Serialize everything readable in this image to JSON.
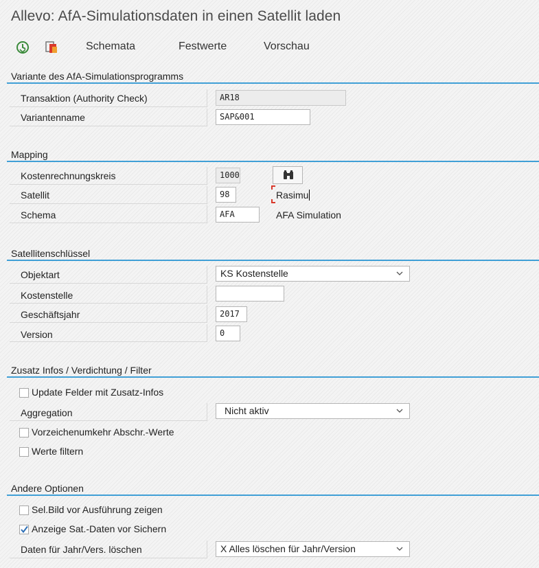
{
  "window": {
    "title": "Allevo: AfA-Simulationsdaten in einen Satellit laden"
  },
  "toolbar": {
    "execute_icon": "execute-clock-icon",
    "variant_icon": "variant-copy-icon",
    "schemata": "Schemata",
    "festwerte": "Festwerte",
    "vorschau": "Vorschau"
  },
  "variante": {
    "title": "Variante des AfA-Simulationsprogramms",
    "transaktion_label": "Transaktion (Authority Check)",
    "transaktion_value": "AR18",
    "variantenname_label": "Variantenname",
    "variantenname_value": "SAP&001"
  },
  "mapping": {
    "title": "Mapping",
    "kostenrechnungskreis_label": "Kostenrechnungskreis",
    "kostenrechnungskreis_value": "1000",
    "satellit_label": "Satellit",
    "satellit_value": "98",
    "satellit_text": "Rasimu",
    "schema_label": "Schema",
    "schema_value": "AFA",
    "schema_text": "AFA Simulation"
  },
  "schluessel": {
    "title": "Satellitenschlüssel",
    "objektart_label": "Objektart",
    "objektart_value": "KS Kostenstelle",
    "kostenstelle_label": "Kostenstelle",
    "kostenstelle_value": "",
    "geschaeftsjahr_label": "Geschäftsjahr",
    "geschaeftsjahr_value": "2017",
    "version_label": "Version",
    "version_value": "0"
  },
  "zusatz": {
    "title": "Zusatz Infos / Verdichtung / Filter",
    "update_label": "Update Felder mit Zusatz-Infos",
    "update_checked": false,
    "aggregation_label": "Aggregation",
    "aggregation_value": "Nicht aktiv",
    "vorzeichen_label": "Vorzeichenumkehr Abschr.-Werte",
    "vorzeichen_checked": false,
    "filter_label": "Werte filtern",
    "filter_checked": false
  },
  "optionen": {
    "title": "Andere Optionen",
    "selbild_label": "Sel.Bild vor Ausführung zeigen",
    "selbild_checked": false,
    "anzeige_label": "Anzeige Sat.-Daten vor Sichern",
    "anzeige_checked": true,
    "loeschen_label": "Daten für Jahr/Vers. löschen",
    "loeschen_value": "X Alles löschen für Jahr/Version"
  },
  "colors": {
    "accent": "#3f9fd6",
    "execute_green": "#3a8a3a",
    "copy_red": "#d9382b",
    "copy_orange": "#f0a030"
  }
}
